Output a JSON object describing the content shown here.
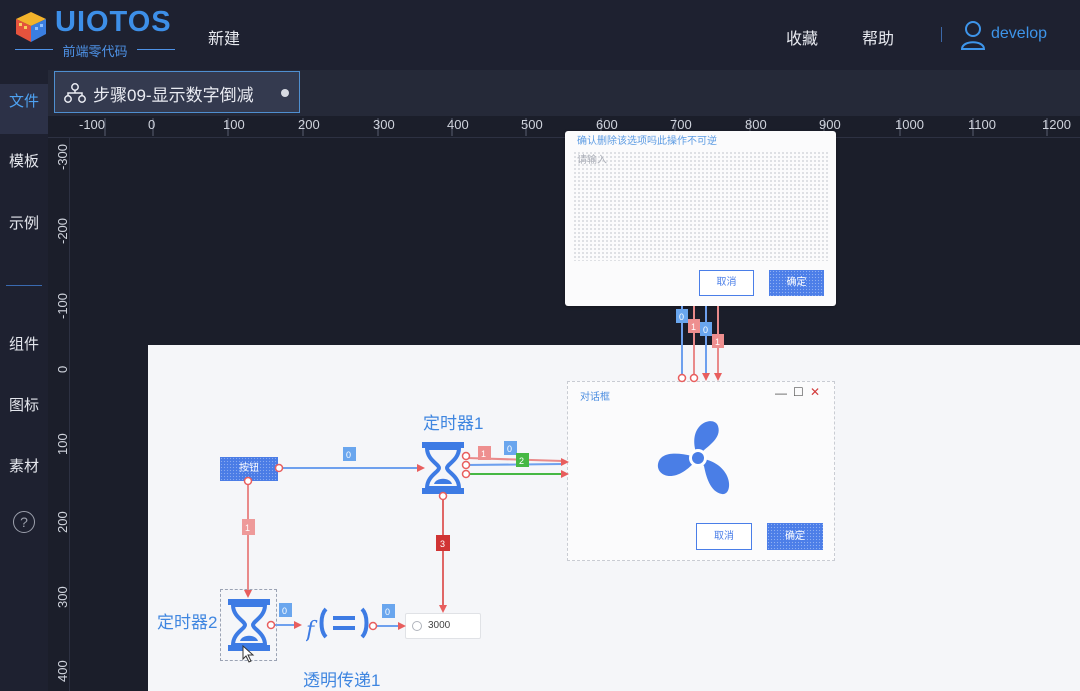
{
  "header": {
    "logo_text": "UIOTOS",
    "logo_sub": "前端零代码",
    "menu_new": "新建",
    "menu_favorites": "收藏",
    "menu_help": "帮助",
    "user_name": "develop",
    "brand_color": "#3d8fe8"
  },
  "sidebar": {
    "items": [
      {
        "label": "文件"
      },
      {
        "label": "模板"
      },
      {
        "label": "示例"
      },
      {
        "label": "组件"
      },
      {
        "label": "图标"
      },
      {
        "label": "素材"
      }
    ],
    "help_glyph": "?"
  },
  "tab": {
    "label": "步骤09-显示数字倒减"
  },
  "ruler": {
    "h_ticks": [
      "-100",
      "0",
      "100",
      "200",
      "300",
      "400",
      "500",
      "600",
      "700",
      "800",
      "900",
      "1000",
      "1100",
      "1200"
    ],
    "v_ticks": [
      "-300",
      "-200",
      "-100",
      "0",
      "100",
      "200",
      "300",
      "400"
    ]
  },
  "dialog1": {
    "title": "确认删除该选项吗此操作不可逆",
    "placeholder": "请输入",
    "cancel": "取消",
    "ok": "确定"
  },
  "dialog2": {
    "title": "对话框",
    "cancel": "取消",
    "ok": "确定"
  },
  "nodes": {
    "button_label": "按钮",
    "timer1_label": "定时器1",
    "timer2_label": "定时器2",
    "transfer_label": "透明传递1",
    "input_value": "3000"
  },
  "link_tags": {
    "btn_to_timer1": "0",
    "btn_to_timer2": "1",
    "timer1_out_a": "0",
    "timer1_out_b": "1",
    "timer1_out_c": "2",
    "timer1_to_input": "3",
    "timer2_to_func": "0",
    "func_to_input": "0",
    "up_a": "0",
    "up_b": "1",
    "up_c": "0",
    "up_d": "1"
  }
}
